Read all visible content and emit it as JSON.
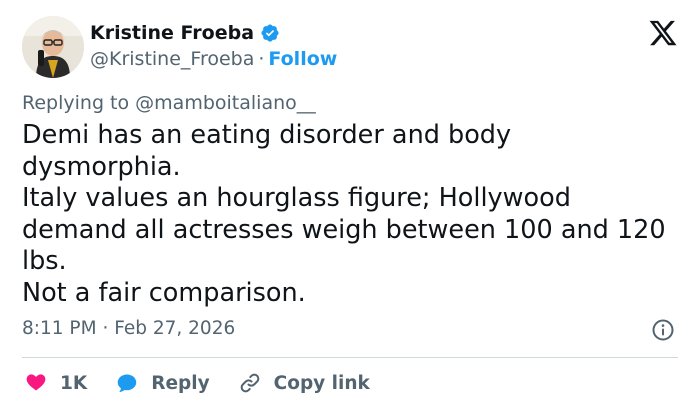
{
  "author": {
    "display_name": "Kristine Froeba",
    "handle": "@Kristine_Froeba",
    "separator": "·",
    "follow_label": "Follow",
    "verified": true
  },
  "reply": {
    "prefix": "Replying to",
    "mention": "@mamboitaliano__"
  },
  "tweet": {
    "lines": [
      "Demi has an eating disorder and body",
      "dysmorphia.",
      "Italy values an hourglass figure; Hollywood",
      "demand all actresses weigh between 100 and 120",
      "lbs.",
      "Not a fair comparison."
    ]
  },
  "meta": {
    "time": "8:11 PM",
    "separator": "·",
    "date": "Feb 27, 2026"
  },
  "actions": {
    "likes_count": "1K",
    "reply_label": "Reply",
    "copy_link_label": "Copy link"
  },
  "colors": {
    "text": "#0f1419",
    "secondary": "#536471",
    "accent": "#1d9bf0",
    "like": "#f91880",
    "divider": "#cfd9de"
  },
  "icons": [
    "verified-badge-icon",
    "x-logo-icon",
    "info-icon",
    "heart-icon",
    "reply-bubble-icon",
    "link-icon"
  ]
}
